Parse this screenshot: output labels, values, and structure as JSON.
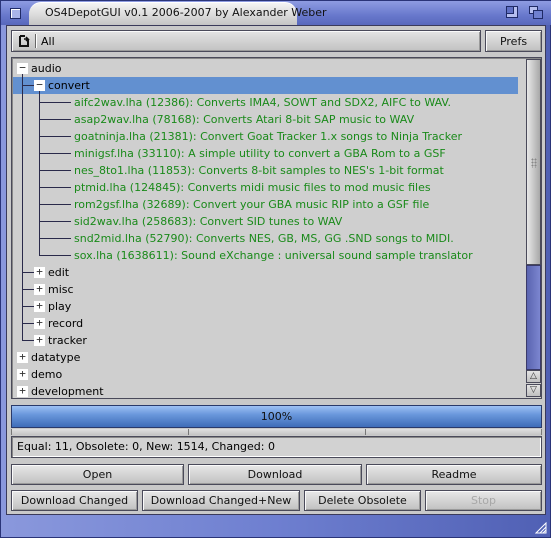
{
  "window": {
    "title": "OS4DepotGUI v0.1 2006-2007 by Alexander Weber"
  },
  "toolbar": {
    "category_value": "All",
    "prefs_label": "Prefs"
  },
  "tree": [
    {
      "label": "audio",
      "level": 0,
      "expanded": true,
      "type": "folder"
    },
    {
      "label": "convert",
      "level": 1,
      "expanded": true,
      "type": "folder",
      "selected": true
    },
    {
      "label": "aifc2wav.lha (12386):  Converts IMA4, SOWT and SDX2, AIFC to WAV.",
      "level": 2,
      "type": "file"
    },
    {
      "label": "asap2wav.lha (78168):  Converts Atari 8-bit SAP music to WAV",
      "level": 2,
      "type": "file"
    },
    {
      "label": "goatninja.lha (21381):  Convert Goat Tracker 1.x songs to Ninja Tracker",
      "level": 2,
      "type": "file"
    },
    {
      "label": "minigsf.lha (33110):  A simple utility to convert a GBA Rom to a GSF",
      "level": 2,
      "type": "file"
    },
    {
      "label": "nes_8to1.lha (11853):  Converts 8-bit samples to NES's 1-bit format",
      "level": 2,
      "type": "file"
    },
    {
      "label": "ptmid.lha (124845):  Converts midi music files to mod music files",
      "level": 2,
      "type": "file"
    },
    {
      "label": "rom2gsf.lha (32689):  Convert your GBA music RIP into a GSF file",
      "level": 2,
      "type": "file"
    },
    {
      "label": "sid2wav.lha (258683):  Convert SID tunes to WAV",
      "level": 2,
      "type": "file"
    },
    {
      "label": "snd2mid.lha (52790):  Converts NES, GB, MS, GG .SND songs to MIDI.",
      "level": 2,
      "type": "file"
    },
    {
      "label": "sox.lha (1638611):  Sound eXchange : universal sound sample translator",
      "level": 2,
      "type": "file"
    },
    {
      "label": "edit",
      "level": 1,
      "expanded": false,
      "type": "folder"
    },
    {
      "label": "misc",
      "level": 1,
      "expanded": false,
      "type": "folder"
    },
    {
      "label": "play",
      "level": 1,
      "expanded": false,
      "type": "folder"
    },
    {
      "label": "record",
      "level": 1,
      "expanded": false,
      "type": "folder"
    },
    {
      "label": "tracker",
      "level": 1,
      "expanded": false,
      "type": "folder"
    },
    {
      "label": "datatype",
      "level": 0,
      "expanded": false,
      "type": "folder"
    },
    {
      "label": "demo",
      "level": 0,
      "expanded": false,
      "type": "folder"
    },
    {
      "label": "development",
      "level": 0,
      "expanded": false,
      "type": "folder"
    }
  ],
  "expander_symbols": {
    "expanded": "−",
    "collapsed": "+"
  },
  "progress": {
    "value_percent": 100,
    "label": "100%"
  },
  "status": {
    "text": "Equal: 11, Obsolete: 0, New: 1514, Changed: 0"
  },
  "buttons": {
    "open": "Open",
    "download": "Download",
    "readme": "Readme",
    "download_changed": "Download Changed",
    "download_changed_new": "Download Changed+New",
    "delete_obsolete": "Delete Obsolete",
    "stop": "Stop"
  },
  "scroll": {
    "up_arrow": "△",
    "down_arrow": "▽"
  }
}
